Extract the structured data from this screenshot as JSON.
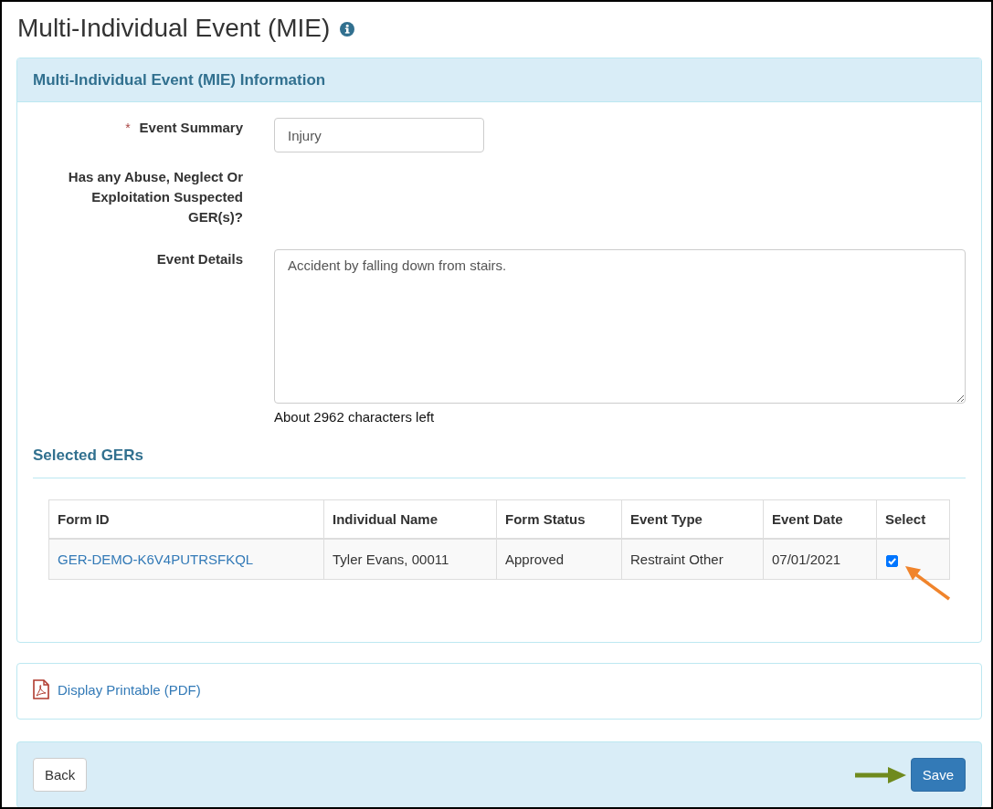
{
  "page": {
    "title": "Multi-Individual Event (MIE)"
  },
  "panel": {
    "title": "Multi-Individual Event (MIE) Information",
    "fields": [
      {
        "kind": "input",
        "required_mark": "*",
        "label": "Event Summary",
        "value": "Injury"
      },
      {
        "kind": "label",
        "label": "Has any Abuse, Neglect Or Exploitation Suspected GER(s)?"
      },
      {
        "kind": "textarea",
        "label": "Event Details",
        "value": "Accident by falling down from stairs.",
        "hint": "About 2962 characters left"
      }
    ],
    "section": {
      "title": "Selected GERs"
    },
    "table": {
      "columns": [
        "Form ID",
        "Individual Name",
        "Form Status",
        "Event Type",
        "Event Date",
        "Select"
      ],
      "rows": [
        {
          "form_id": "GER-DEMO-K6V4PUTRSFKQL",
          "individual_name": "Tyler Evans, 00011",
          "form_status": "Approved",
          "event_type": "Restraint Other",
          "event_date": "07/01/2021",
          "selected": true
        }
      ]
    }
  },
  "links": [
    {
      "label": "Display Printable (PDF)"
    }
  ],
  "footer": {
    "buttons": [
      {
        "label": "Back",
        "kind": "default"
      },
      {
        "label": "Save",
        "kind": "primary"
      }
    ]
  }
}
